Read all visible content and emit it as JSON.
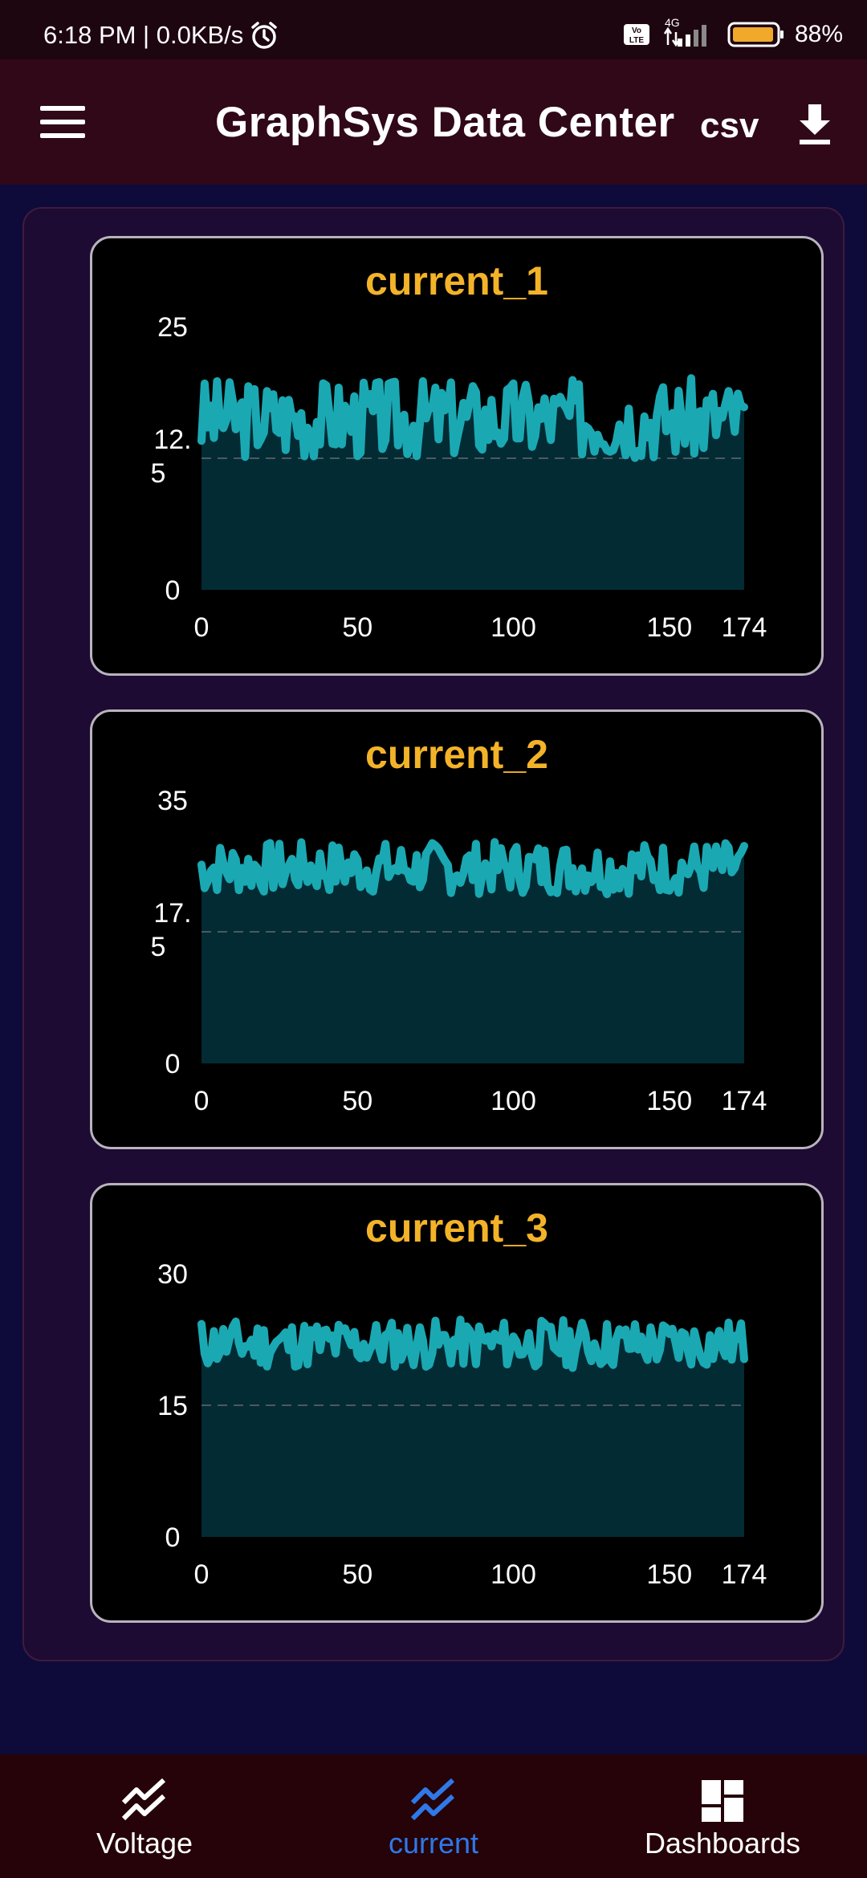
{
  "status_bar": {
    "time_speed": "6:18 PM | 0.0KB/s",
    "network": "4G",
    "battery": "88%"
  },
  "app_bar": {
    "title": "GraphSys Data Center",
    "csv_label": "csv"
  },
  "colors": {
    "accent_title": "#f3b329",
    "line": "#1aa9b3",
    "fill": "#032b34",
    "nav_active": "#2f78e8"
  },
  "chart_data": [
    {
      "type": "area",
      "title": "current_1",
      "x_ticks": [
        "0",
        "50",
        "100",
        "150",
        "174"
      ],
      "y_ticks": [
        "0",
        "12.5",
        "25"
      ],
      "xlim": [
        0,
        174
      ],
      "ylim": [
        0,
        25
      ],
      "baseline": 16.3,
      "amplitude": 3.8,
      "seed": 3
    },
    {
      "type": "area",
      "title": "current_2",
      "x_ticks": [
        "0",
        "50",
        "100",
        "150",
        "174"
      ],
      "y_ticks": [
        "0",
        "17.5",
        "35"
      ],
      "xlim": [
        0,
        174
      ],
      "ylim": [
        0,
        35
      ],
      "baseline": 26.0,
      "amplitude": 3.5,
      "seed": 7
    },
    {
      "type": "area",
      "title": "current_3",
      "x_ticks": [
        "0",
        "50",
        "100",
        "150",
        "174"
      ],
      "y_ticks": [
        "0",
        "15",
        "30"
      ],
      "xlim": [
        0,
        174
      ],
      "ylim": [
        0,
        30
      ],
      "baseline": 22.0,
      "amplitude": 2.8,
      "seed": 11
    }
  ],
  "bottom_nav": {
    "items": [
      {
        "label": "Voltage",
        "active": false
      },
      {
        "label": "current",
        "active": true
      },
      {
        "label": "Dashboards",
        "active": false
      }
    ]
  }
}
